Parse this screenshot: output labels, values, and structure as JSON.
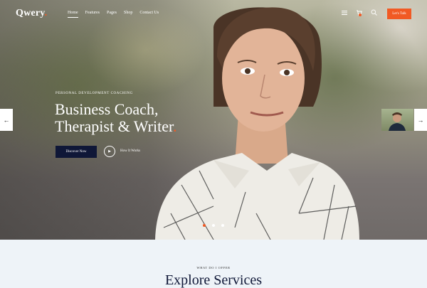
{
  "brand": {
    "logo_text": "Qwery",
    "logo_dot": ".",
    "accent_color": "#f15a24",
    "navy_color": "#0f1737"
  },
  "nav": {
    "items": [
      {
        "label": "Home",
        "active": true
      },
      {
        "label": "Features",
        "active": false
      },
      {
        "label": "Pages",
        "active": false
      },
      {
        "label": "Shop",
        "active": false
      },
      {
        "label": "Contact Us",
        "active": false
      }
    ],
    "icons": [
      "menu-icon",
      "cart-icon",
      "search-icon"
    ],
    "cta_label": "Let's Talk"
  },
  "hero": {
    "eyebrow": "PERSONAL DEVELOPMENT COACHING",
    "headline_line1": "Business Coach,",
    "headline_line2": "Therapist & Writer",
    "headline_dot": ".",
    "primary_button": "Discover Now",
    "secondary_label": "How It Works",
    "slider_arrows": {
      "prev": "←",
      "next": "→"
    },
    "slide_count": 3,
    "active_slide": 1
  },
  "services": {
    "eyebrow": "WHAT DO I OFFER",
    "title": "Explore Services"
  }
}
